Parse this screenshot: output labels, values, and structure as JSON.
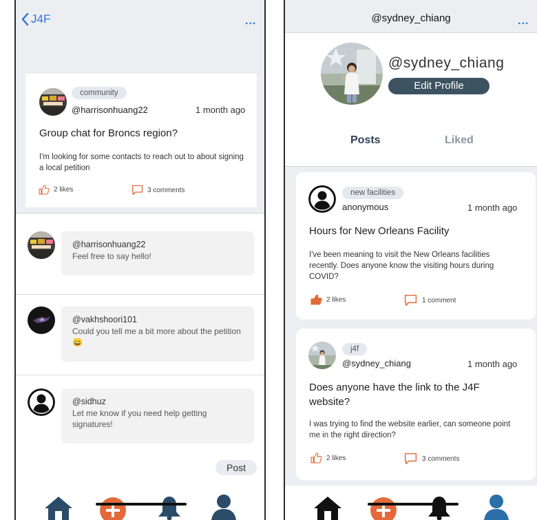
{
  "left": {
    "header": {
      "back_label": "J4F",
      "more_label": "..."
    },
    "post": {
      "tag": "community",
      "username": "@harrisonhuang22",
      "time": "1 month ago",
      "title": "Group chat for Broncs region?",
      "body": "I'm looking for some contacts to reach out to about signing a local petition",
      "likes": "2 likes",
      "comments": "3 comments"
    },
    "comments": [
      {
        "username": "@harrisonhuang22",
        "text": "Feel free to say hello!"
      },
      {
        "username": "@vakhshoori101",
        "text": "Could you tell me a bit more about the petition 😄"
      },
      {
        "username": "@sidhuz",
        "text": "Let me know if you need help getting signatures!"
      }
    ],
    "post_button": "Post"
  },
  "right": {
    "title": "@sydney_chiang",
    "more_label": "...",
    "profile": {
      "name": "@sydney_chiang",
      "edit_label": "Edit Profile"
    },
    "tabs": {
      "posts": "Posts",
      "liked": "Liked"
    },
    "posts": [
      {
        "tag": "new facilities",
        "username": "anonymous",
        "time": "1 month ago",
        "title": "Hours for New Orleans Facility",
        "body": "I've been meaning to visit the New Orleans facilities recently. Does anyone know the visiting hours during COVID?",
        "likes": "2 likes",
        "comments": "1 comment"
      },
      {
        "tag": "j4f",
        "username": "@sydney_chiang",
        "time": "1 month ago",
        "title": "Does anyone have the link to the J4F website?",
        "body": "I was trying to find the website earlier, can someone point me in the right direction?",
        "likes": "2 likes",
        "comments": "3 comments"
      }
    ]
  },
  "colors": {
    "accent_blue": "#2f6fe0",
    "nav_blue": "#2c4b69",
    "add_orange": "#e4693a",
    "edit_button": "#3c5260",
    "like_orange": "#e4693a"
  },
  "icons": [
    "back-chevron-icon",
    "thumbs-up-icon",
    "comment-icon",
    "home-icon",
    "add-icon",
    "bell-icon",
    "person-icon"
  ]
}
